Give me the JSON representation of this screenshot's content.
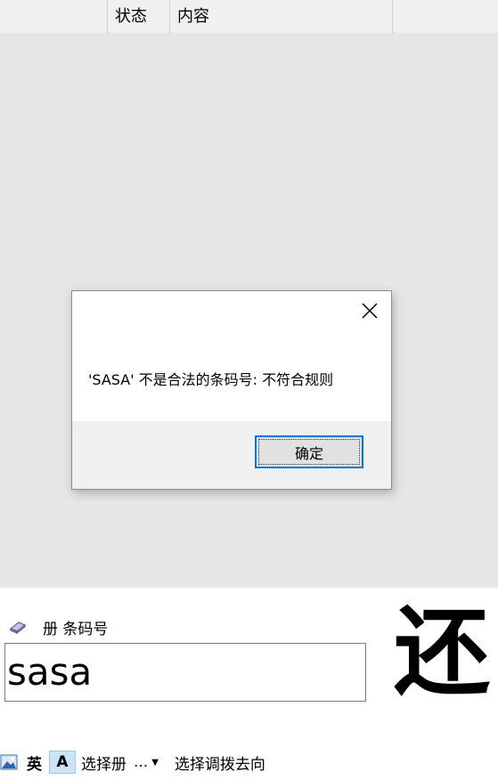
{
  "list": {
    "columns": [
      "",
      "状态",
      "内容",
      ""
    ]
  },
  "dialog": {
    "message": "'SASA' 不是合法的条码号: 不符合规则",
    "ok_label": "确定",
    "close_icon": "close-icon"
  },
  "panel": {
    "barcode_label": "册 条码号",
    "barcode_value": "sasa",
    "action_glyph": "还",
    "book_icon": "book-icon"
  },
  "toolbar": {
    "picture_icon": "picture-icon",
    "lang_label": "英",
    "font_label": "A",
    "select_item_label": "选择册",
    "more_label": "...",
    "dropdown_icon": "chevron-down-icon",
    "select_direction_label": "选择调拨去向"
  },
  "colors": {
    "list_header": "#f0f0f0",
    "list_body": "#e6e6e6",
    "accent": "#0078d7",
    "font_button_bg": "#cce4f7"
  }
}
